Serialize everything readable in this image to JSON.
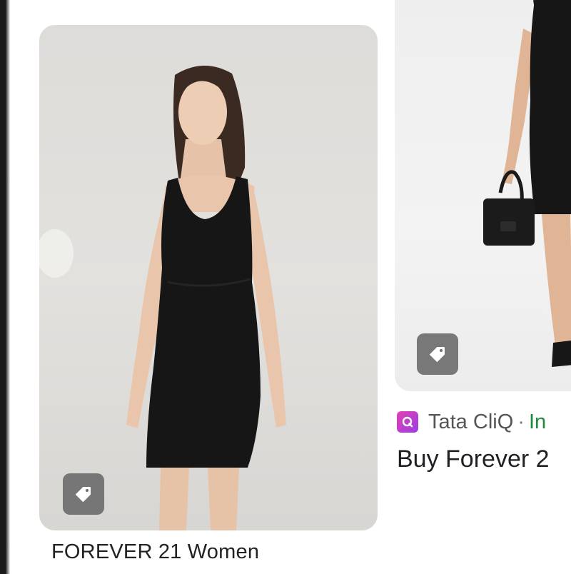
{
  "cards": [
    {
      "title": "FOREVER 21 Women",
      "tag_icon": "tag-icon"
    },
    {
      "source": {
        "icon": "tata-cliq-logo-icon",
        "name": "Tata CliQ",
        "separator": "·",
        "stock": "In"
      },
      "title": "Buy Forever 2",
      "tag_icon": "tag-icon"
    }
  ],
  "colors": {
    "stock_green": "#1b8a3a",
    "source_icon_pink": "#e33fb4",
    "dress_black": "#161616"
  }
}
